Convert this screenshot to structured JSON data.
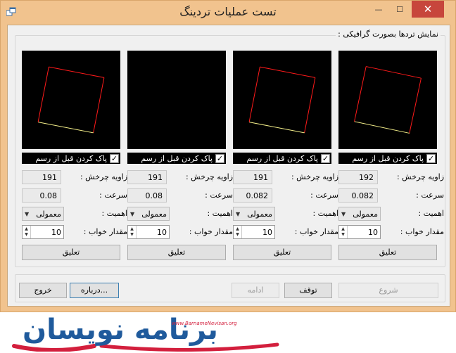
{
  "window": {
    "title": "تست عملیات تردینگ",
    "minimize_glyph": "—",
    "maximize_glyph": "☐",
    "close_glyph": "✕"
  },
  "group": {
    "title": "نمایش تردها بصورت گرافیکی :"
  },
  "labels": {
    "clear_before_draw": "پاک کردن قبل از رسم",
    "rotation_angle": "زاویه چرخش :",
    "speed": "سرعت :",
    "priority": "اهمیت :",
    "sleep_amount": "مقدار خواب :",
    "suspend": "تعلیق"
  },
  "columns": [
    {
      "angle": "191",
      "speed": "0.08",
      "priority": "معمولی",
      "sleep": "10",
      "clear_checked": true
    },
    {
      "angle": "191",
      "speed": "0.08",
      "priority": "معمولی",
      "sleep": "10",
      "clear_checked": true
    },
    {
      "angle": "191",
      "speed": "0.082",
      "priority": "معمولی",
      "sleep": "10",
      "clear_checked": true
    },
    {
      "angle": "192",
      "speed": "0.082",
      "priority": "معمولی",
      "sleep": "10",
      "clear_checked": true
    }
  ],
  "buttons": {
    "start": "شروع",
    "stop": "توقف",
    "resume": "ادامه",
    "about": "درباره...",
    "exit": "خروج"
  },
  "checkbox_glyph": "✓",
  "icons": {
    "app": "app-window-icon",
    "spin_up": "▲",
    "spin_down": "▼",
    "combo_arrow": "▼"
  },
  "logo": {
    "text": "برنامه نویسان",
    "url": "www.BarnameNevisan.org"
  },
  "colors": {
    "square_main": "#ff1a1a",
    "square_edge": "#f5f08a",
    "logo_blue": "#1f5a9c",
    "logo_red": "#d31f3d"
  }
}
